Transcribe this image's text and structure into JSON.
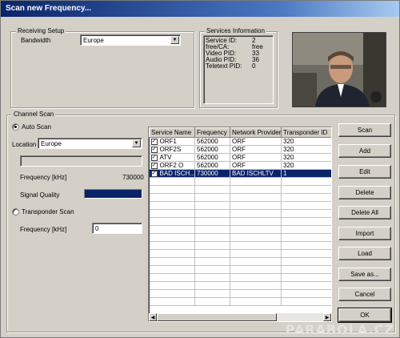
{
  "window": {
    "title": "Scan new Frequency..."
  },
  "receiving_setup": {
    "title": "Receiving Setup",
    "bandwidth_label": "Bandwidth",
    "bandwidth_value": "Europe"
  },
  "services_info": {
    "title": "Services Information",
    "rows": [
      {
        "label": "Service ID:",
        "value": "2"
      },
      {
        "label": "free/CA:",
        "value": "free"
      },
      {
        "label": "Video PID:",
        "value": "33"
      },
      {
        "label": "Audio PID:",
        "value": "36"
      },
      {
        "label": "Teletext PID:",
        "value": "0"
      }
    ]
  },
  "channel_scan": {
    "title": "Channel Scan",
    "auto_scan_label": "Auto Scan",
    "location_label": "Location",
    "location_value": "Europe",
    "frequency_label": "Frequency [kHz]",
    "frequency_value": "730000",
    "signal_quality_label": "Signal Quality",
    "signal_quality_level": 1.0,
    "transponder_scan_label": "Transponder Scan",
    "transponder_frequency_label": "Frequency [kHz]",
    "transponder_frequency_value": "0"
  },
  "table": {
    "headers": [
      "Service Name",
      "Frequency",
      "Network Provider",
      "Transponder ID"
    ],
    "rows": [
      [
        "ORF1",
        "562000",
        "ORF",
        "320"
      ],
      [
        "ORF2S",
        "562000",
        "ORF",
        "320"
      ],
      [
        "ATV",
        "562000",
        "ORF",
        "320"
      ],
      [
        "ORF2 O",
        "562000",
        "ORF",
        "320"
      ],
      [
        "BAD ISCH...",
        "730000",
        "BAD ISCHLTV",
        "1"
      ]
    ],
    "selected_row": 4
  },
  "buttons": {
    "scan": "Scan",
    "add": "Add",
    "edit": "Edit",
    "delete": "Delete",
    "delete_all": "Delete All",
    "import": "Import",
    "load": "Load",
    "save_as": "Save as...",
    "cancel": "Cancel",
    "ok": "OK"
  },
  "watermark": "PARABOLA.CZ",
  "colors": {
    "titlebar": "#0a246a",
    "selection": "#0a246a",
    "dialog": "#d4d0c8",
    "signal_bar": "#0a246a"
  }
}
